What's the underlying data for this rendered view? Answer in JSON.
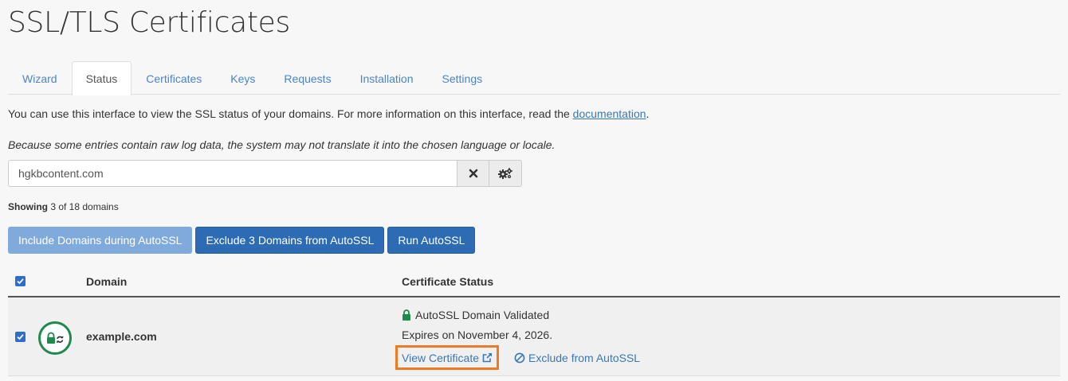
{
  "page": {
    "title": "SSL/TLS Certificates"
  },
  "tabs": [
    {
      "label": "Wizard"
    },
    {
      "label": "Status",
      "active": true
    },
    {
      "label": "Certificates"
    },
    {
      "label": "Keys"
    },
    {
      "label": "Requests"
    },
    {
      "label": "Installation"
    },
    {
      "label": "Settings"
    }
  ],
  "intro": {
    "text": "You can use this interface to view the SSL status of your domains. For more information on this interface, read the ",
    "link": "documentation",
    "end": "."
  },
  "note": "Because some entries contain raw log data, the system may not translate it into the chosen language or locale.",
  "search": {
    "value": "hgkbcontent.com",
    "clear_icon": "times-icon",
    "options_icon": "cogs-icon"
  },
  "showing": {
    "label": "Showing",
    "text": " 3 of 18 domains"
  },
  "buttons": {
    "include": "Include Domains during AutoSSL",
    "exclude": "Exclude 3 Domains from AutoSSL",
    "run": "Run AutoSSL"
  },
  "table": {
    "headers": {
      "domain": "Domain",
      "status": "Certificate Status"
    },
    "rows": [
      {
        "domain": "example.com",
        "status": "AutoSSL Domain Validated",
        "expires": "Expires on November 4, 2026.",
        "view_link": "View Certificate",
        "exclude_link": "Exclude from AutoSSL"
      }
    ]
  },
  "colors": {
    "link": "#3a77b5",
    "primary_button": "#2d6cb5",
    "disabled_button": "#80aadb",
    "valid_green": "#1f8a4c",
    "highlight_orange": "#ee7a26"
  }
}
